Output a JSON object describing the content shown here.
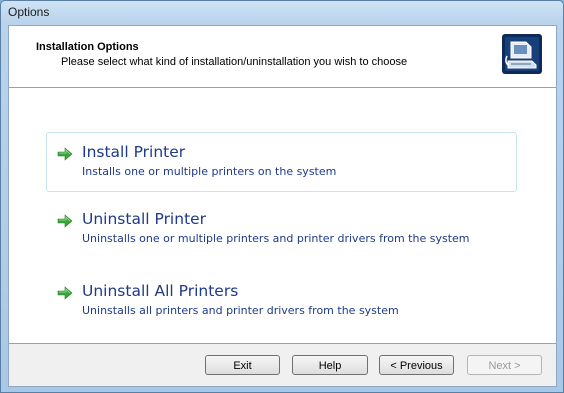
{
  "window": {
    "title": "Options"
  },
  "header": {
    "title": "Installation Options",
    "subtitle": "Please select what kind of installation/uninstallation you wish to choose",
    "icon": "printer-computer-icon"
  },
  "options": [
    {
      "title": "Install Printer",
      "description": "Installs one or multiple printers on the system",
      "icon": "green-arrow-icon",
      "selected": true
    },
    {
      "title": "Uninstall Printer",
      "description": "Uninstalls one or multiple printers and printer drivers from the system",
      "icon": "green-arrow-icon",
      "selected": false
    },
    {
      "title": "Uninstall All Printers",
      "description": "Uninstalls all printers and printer drivers from the system",
      "icon": "green-arrow-icon",
      "selected": false
    }
  ],
  "buttons": {
    "exit": "Exit",
    "help": "Help",
    "previous": "< Previous",
    "next": "Next >"
  },
  "colors": {
    "option_text": "#1e3a8a",
    "arrow_green": "#3aa63a",
    "selected_border": "#c5e6ef"
  }
}
